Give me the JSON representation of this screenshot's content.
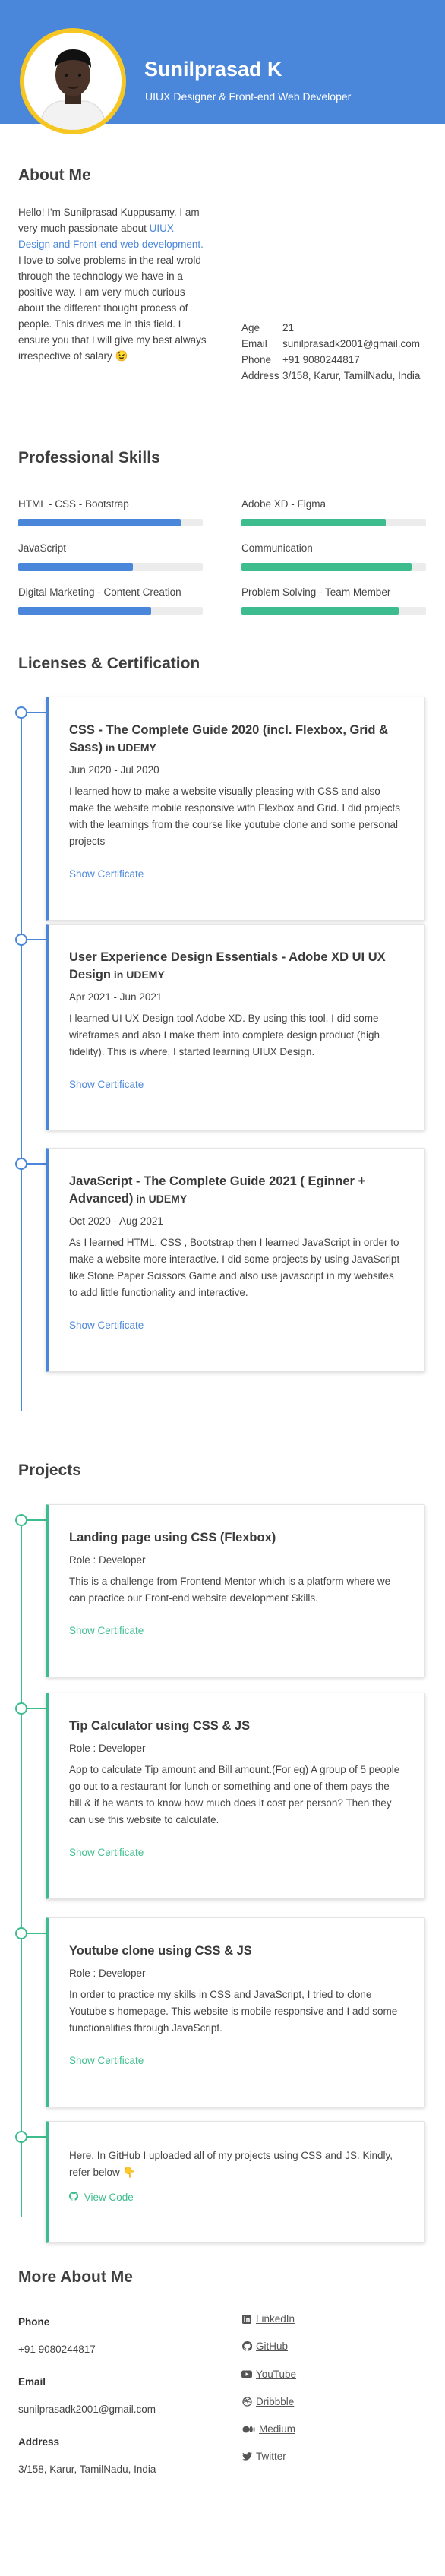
{
  "hero": {
    "name": "Sunilprasad K",
    "subtitle": "UIUX Designer & Front-end Web Developer"
  },
  "about": {
    "heading": "About Me",
    "text_part1": "Hello! I'm Sunilprasad Kuppusamy. I am very much passionate about ",
    "text_accent": "UIUX Design and Front-end web development.",
    "text_part2": " I love to solve problems in the real wrold through the technology we have in a positive way. I am very much curious about the different thought process of people. This drives me in this field. I ensure you that I will give my best always irrespective of salary ",
    "emoji": "😉",
    "info": [
      {
        "key": "Age",
        "value": "21"
      },
      {
        "key": "Email",
        "value": "sunilprasadk2001@gmail.com"
      },
      {
        "key": "Phone",
        "value": "+91 9080244817"
      },
      {
        "key": "Address",
        "value": "3/158, Karur, TamilNadu, India"
      }
    ]
  },
  "skills": {
    "heading": "Professional Skills",
    "items": [
      {
        "label": "HTML - CSS - Bootstrap",
        "level": 0.88,
        "color": "#4a86d9"
      },
      {
        "label": "Adobe XD - Figma",
        "level": 0.78,
        "color": "#3dbd8e"
      },
      {
        "label": "JavaScript",
        "level": 0.62,
        "color": "#4a86d9"
      },
      {
        "label": "Communication",
        "level": 0.92,
        "color": "#3dbd8e"
      },
      {
        "label": "Digital Marketing - Content Creation",
        "level": 0.72,
        "color": "#4a86d9"
      },
      {
        "label": "Problem Solving - Team Member",
        "level": 0.85,
        "color": "#3dbd8e"
      }
    ]
  },
  "licenses": {
    "heading": "Licenses & Certification",
    "items": [
      {
        "title": "CSS - The Complete Guide 2020 (incl. Flexbox, Grid & Sass)",
        "issuer_prefix": " in ",
        "issuer": "UDEMY",
        "date": "Jun 2020 - Jul 2020",
        "desc": "I learned how to make a website visually pleasing with CSS and also make the website mobile responsive with Flexbox and Grid. I did projects with the learnings from the course like youtube clone and some personal projects",
        "link": "Show Certificate"
      },
      {
        "title": "User Experience Design Essentials - Adobe XD UI UX Design",
        "issuer_prefix": " in ",
        "issuer": "UDEMY",
        "date": "Apr 2021 - Jun 2021",
        "desc": "I learned UI UX Design tool Adobe XD. By using this tool, I did some wireframes and also I make them into complete design product (high fidelity). This is where, I started learning UIUX Design.",
        "link": "Show Certificate"
      },
      {
        "title": "JavaScript - The Complete Guide 2021 ( Eginner + Advanced)",
        "issuer_prefix": " in ",
        "issuer": "UDEMY",
        "date": "Oct 2020 - Aug 2021",
        "desc": "As I learned HTML, CSS , Bootstrap then I learned JavaScript in order to make a website more interactive. I did some projects by using JavaScript like Stone Paper Scissors Game and also use javascript in my websites to add little functionality and interactive.",
        "link": "Show Certificate"
      }
    ]
  },
  "projects": {
    "heading": "Projects",
    "items": [
      {
        "title": "Landing page using CSS (Flexbox)",
        "role": "Role : Developer",
        "desc": "This is a challenge from Frontend Mentor which is a platform where we can practice our Front-end website development Skills.",
        "link": "Show Certificate"
      },
      {
        "title": "Tip Calculator using CSS & JS",
        "role": "Role : Developer",
        "desc": "App to calculate Tip amount and Bill amount.(For eg) A group of 5 people go out to a restaurant for lunch or something and one of them pays the bill & if he wants to know how much does it cost per person? Then they can use this website to calculate.",
        "link": "Show Certificate"
      },
      {
        "title": "Youtube clone using CSS & JS",
        "role": "Role : Developer",
        "desc": "In order to practice my skills in CSS and JavaScript, I tried to clone Youtube s homepage. This website is mobile responsive and I add some functionalities through JavaScript.",
        "link": "Show Certificate"
      }
    ],
    "github": {
      "text": "Here, In GitHub I uploaded all of my projects using CSS and JS. Kindly, refer below ",
      "emoji": "👇",
      "link": "View Code"
    }
  },
  "more": {
    "heading": "More About Me",
    "phone_label": "Phone",
    "phone": "+91 9080244817",
    "email_label": "Email",
    "email": "sunilprasadk2001@gmail.com",
    "address_label": "Address",
    "address": "3/158, Karur, TamilNadu, India",
    "socials": [
      {
        "label": "LinkedIn",
        "icon": "linkedin-icon"
      },
      {
        "label": "GitHub",
        "icon": "github-icon"
      },
      {
        "label": "YouTube",
        "icon": "youtube-icon"
      },
      {
        "label": "Dribbble",
        "icon": "dribbble-icon"
      },
      {
        "label": "Medium",
        "icon": "medium-icon"
      },
      {
        "label": "Twitter",
        "icon": "twitter-icon"
      }
    ]
  },
  "colors": {
    "primary": "#4a86d9",
    "accent_green": "#3dbd8e",
    "avatar_ring": "#f6c623"
  }
}
